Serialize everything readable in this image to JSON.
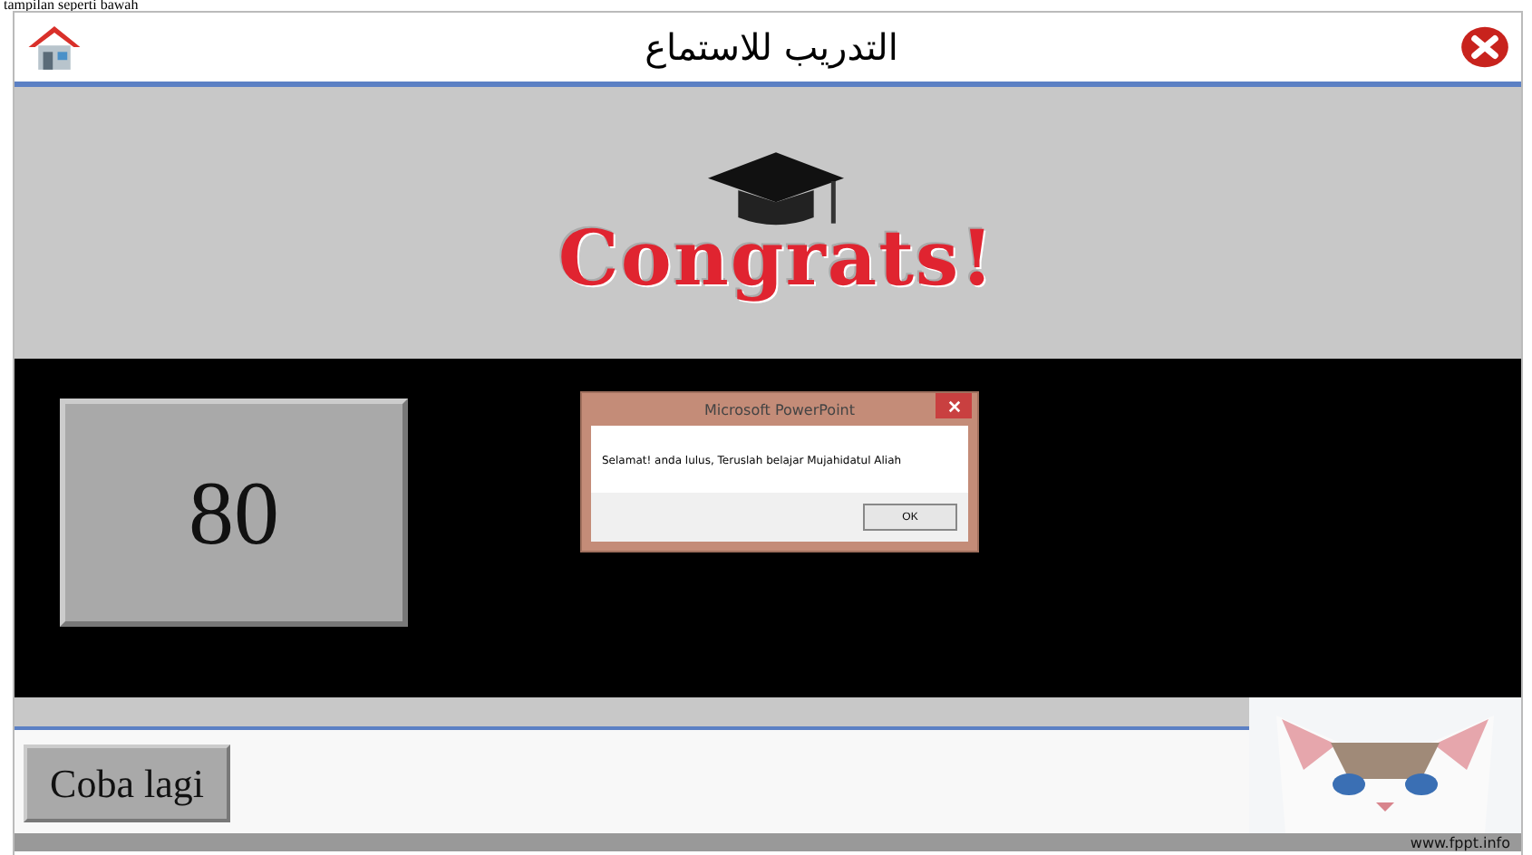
{
  "caption": "tampilan seperti bawah",
  "header": {
    "title": "التدريب للاستماع"
  },
  "banner": {
    "text": "Congrats!"
  },
  "score": "80",
  "dialog": {
    "title": "Microsoft PowerPoint",
    "message": "Selamat! anda lulus, Teruslah belajar Mujahidatul Aliah",
    "button": "OK"
  },
  "retry_button": "Coba lagi",
  "footer": {
    "url": "www.fppt.info",
    "kind": "picture"
  }
}
